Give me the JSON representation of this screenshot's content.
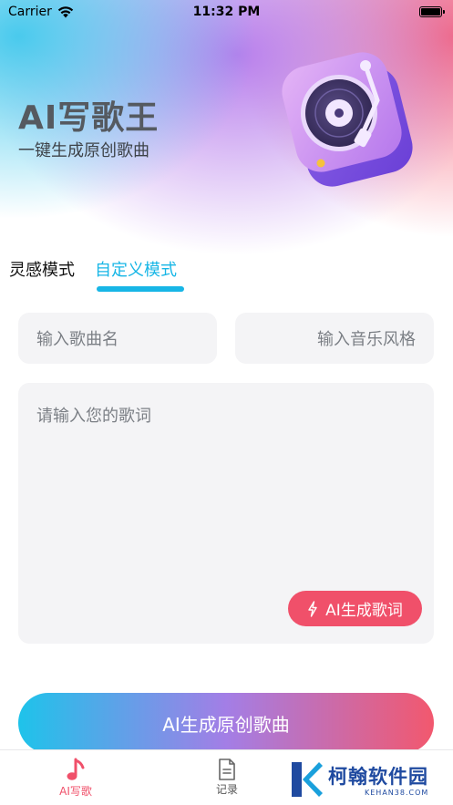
{
  "status_bar": {
    "carrier": "Carrier",
    "time": "11:32 PM"
  },
  "header": {
    "title": "AI写歌王",
    "subtitle": "一键生成原创歌曲"
  },
  "tabs": [
    {
      "label": "灵感模式",
      "active": false
    },
    {
      "label": "自定义模式",
      "active": true
    }
  ],
  "form": {
    "song_name_placeholder": "输入歌曲名",
    "music_style_placeholder": "输入音乐风格",
    "lyrics_placeholder": "请输入您的歌词",
    "ai_lyrics_button": "AI生成歌词"
  },
  "main_button": "AI生成原创歌曲",
  "tabbar": [
    {
      "label": "AI写歌",
      "icon": "music-note-icon",
      "active": true
    },
    {
      "label": "记录",
      "icon": "document-icon",
      "active": false
    }
  ],
  "watermark": {
    "name": "柯翰软件园",
    "url": "KEHAN38.COM"
  },
  "colors": {
    "accent_blue": "#17b6e6",
    "accent_red": "#f0506a",
    "gradient": [
      "#1ec3ea",
      "#a37ee6",
      "#f2586e"
    ]
  }
}
